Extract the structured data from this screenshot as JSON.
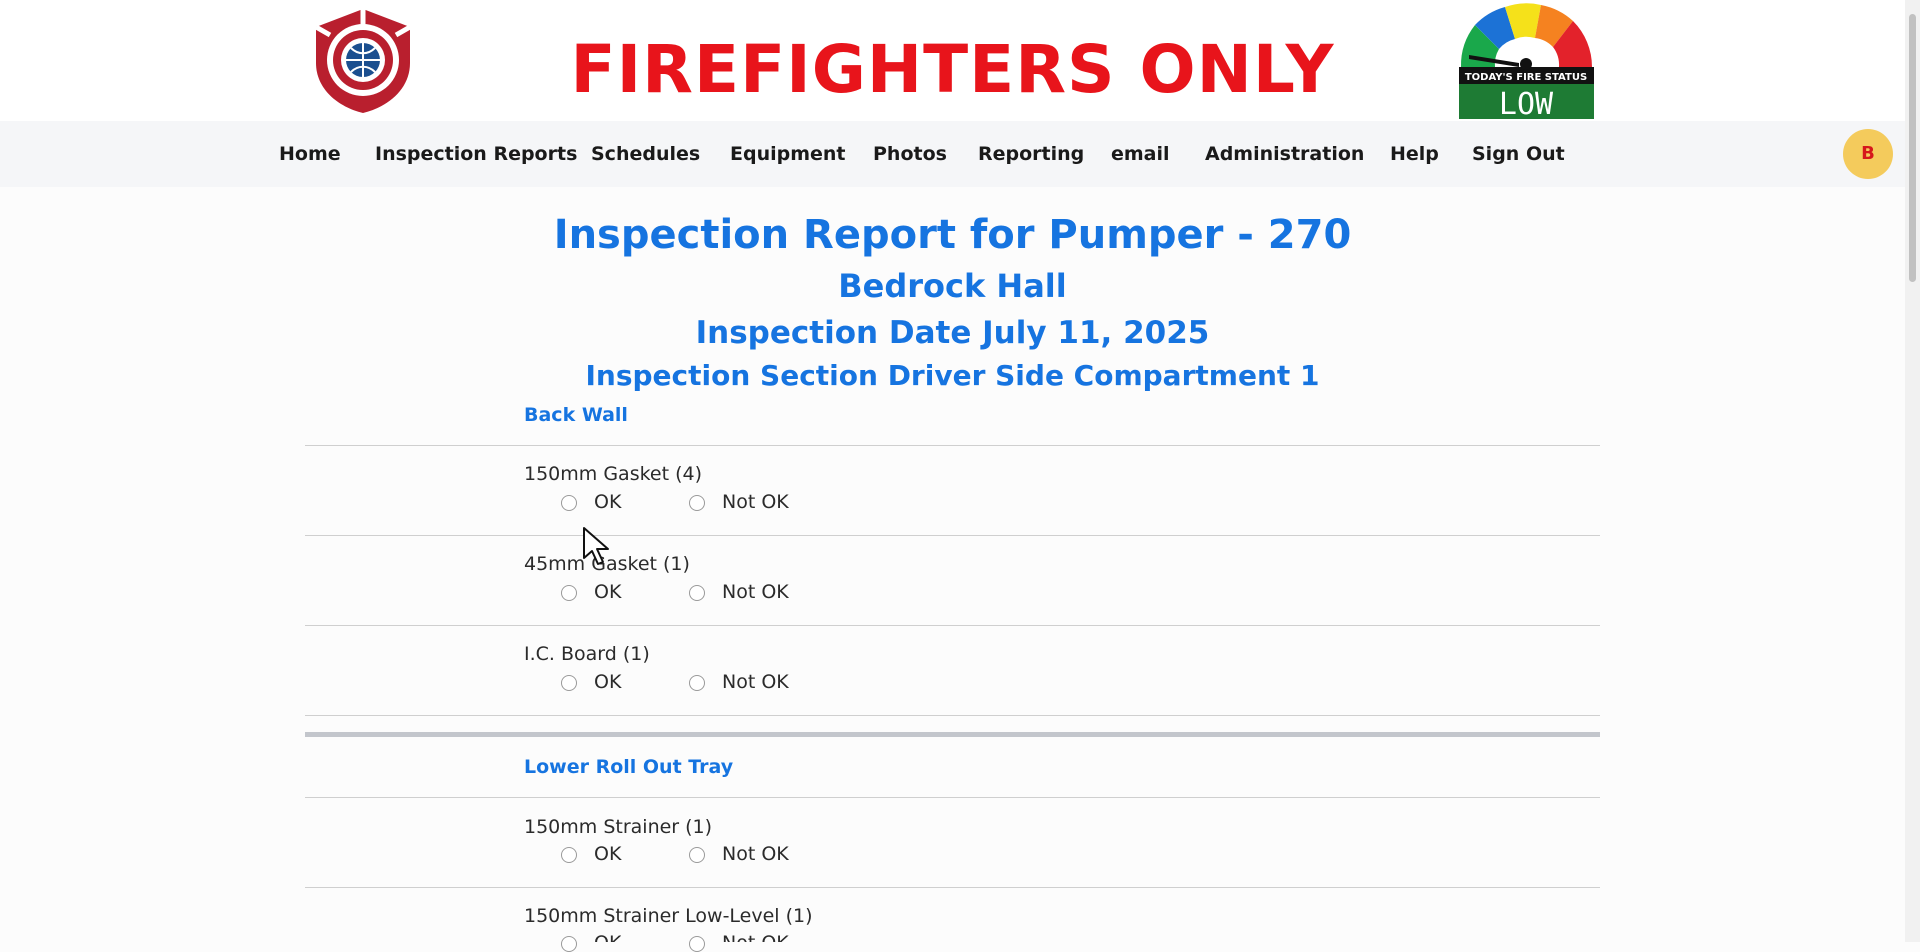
{
  "header": {
    "site_title": "FIREFIGHTERS ONLY",
    "fire_status_caption": "TODAY'S FIRE STATUS",
    "fire_status_value": "LOW"
  },
  "nav": {
    "items": [
      "Home",
      "Inspection Reports",
      "Schedules",
      "Equipment",
      "Photos",
      "Reporting",
      "email",
      "Administration",
      "Help",
      "Sign Out"
    ],
    "avatar_initial": "B"
  },
  "report": {
    "title": "Inspection Report for Pumper - 270",
    "hall": "Bedrock Hall",
    "date": "Inspection Date July 11, 2025",
    "section": "Inspection Section Driver Side Compartment 1"
  },
  "groups": [
    {
      "title": "Back Wall",
      "items": [
        {
          "label": "150mm Gasket (4)",
          "ok": "OK",
          "not_ok": "Not OK"
        },
        {
          "label": "45mm Gasket (1)",
          "ok": "OK",
          "not_ok": "Not OK"
        },
        {
          "label": "I.C. Board (1)",
          "ok": "OK",
          "not_ok": "Not OK"
        }
      ]
    },
    {
      "title": "Lower Roll Out Tray",
      "items": [
        {
          "label": "150mm Strainer (1)",
          "ok": "OK",
          "not_ok": "Not OK"
        },
        {
          "label": "150mm Strainer Low-Level (1)",
          "ok": "OK",
          "not_ok": "Not OK"
        }
      ]
    }
  ],
  "colors": {
    "brand_red": "#e8141b",
    "heading_blue": "#1674e0",
    "avatar_bg": "#f4cb5c",
    "gauge_green": "#1e7b34"
  }
}
